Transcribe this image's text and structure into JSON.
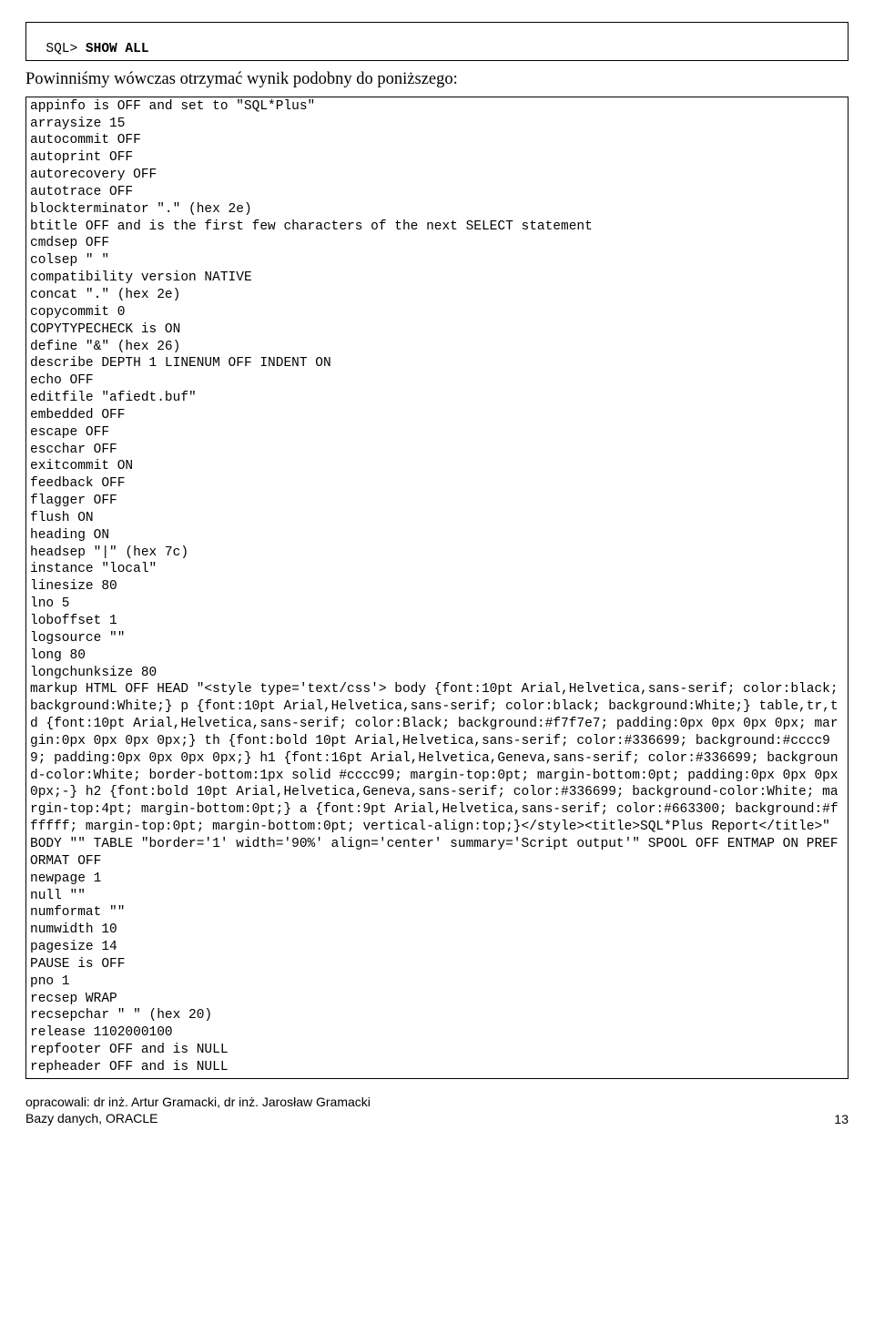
{
  "prompt_prefix": "SQL> ",
  "prompt_command": "SHOW ALL",
  "intro_text": "Powinniśmy wówczas otrzymać wynik podobny do poniższego:",
  "output_text": "appinfo is OFF and set to \"SQL*Plus\"\narraysize 15\nautocommit OFF\nautoprint OFF\nautorecovery OFF\nautotrace OFF\nblockterminator \".\" (hex 2e)\nbtitle OFF and is the first few characters of the next SELECT statement\ncmdsep OFF\ncolsep \" \"\ncompatibility version NATIVE\nconcat \".\" (hex 2e)\ncopycommit 0\nCOPYTYPECHECK is ON\ndefine \"&\" (hex 26)\ndescribe DEPTH 1 LINENUM OFF INDENT ON\necho OFF\neditfile \"afiedt.buf\"\nembedded OFF\nescape OFF\nescchar OFF\nexitcommit ON\nfeedback OFF\nflagger OFF\nflush ON\nheading ON\nheadsep \"|\" (hex 7c)\ninstance \"local\"\nlinesize 80\nlno 5\nloboffset 1\nlogsource \"\"\nlong 80\nlongchunksize 80\nmarkup HTML OFF HEAD \"<style type='text/css'> body {font:10pt Arial,Helvetica,sans-serif; color:black; background:White;} p {font:10pt Arial,Helvetica,sans-serif; color:black; background:White;} table,tr,td {font:10pt Arial,Helvetica,sans-serif; color:Black; background:#f7f7e7; padding:0px 0px 0px 0px; margin:0px 0px 0px 0px;} th {font:bold 10pt Arial,Helvetica,sans-serif; color:#336699; background:#cccc99; padding:0px 0px 0px 0px;} h1 {font:16pt Arial,Helvetica,Geneva,sans-serif; color:#336699; background-color:White; border-bottom:1px solid #cccc99; margin-top:0pt; margin-bottom:0pt; padding:0px 0px 0px 0px;-} h2 {font:bold 10pt Arial,Helvetica,Geneva,sans-serif; color:#336699; background-color:White; margin-top:4pt; margin-bottom:0pt;} a {font:9pt Arial,Helvetica,sans-serif; color:#663300; background:#ffffff; margin-top:0pt; margin-bottom:0pt; vertical-align:top;}</style><title>SQL*Plus Report</title>\" BODY \"\" TABLE \"border='1' width='90%' align='center' summary='Script output'\" SPOOL OFF ENTMAP ON PREFORMAT OFF\nnewpage 1\nnull \"\"\nnumformat \"\"\nnumwidth 10\npagesize 14\nPAUSE is OFF\npno 1\nrecsep WRAP\nrecsepchar \" \" (hex 20)\nrelease 1102000100\nrepfooter OFF and is NULL\nrepheader OFF and is NULL",
  "footer": {
    "line1": "opracowali: dr inż. Artur Gramacki, dr inż. Jarosław Gramacki",
    "line2": "Bazy danych, ORACLE",
    "page_number": "13"
  }
}
